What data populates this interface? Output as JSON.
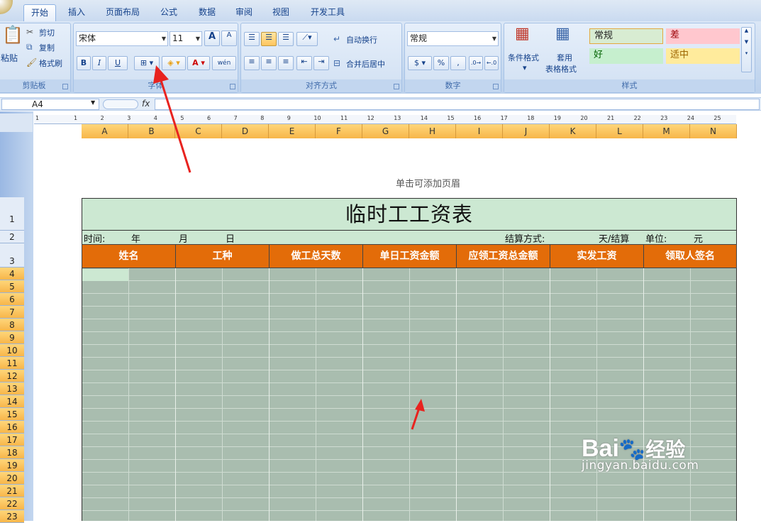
{
  "tabs": [
    "开始",
    "插入",
    "页面布局",
    "公式",
    "数据",
    "审阅",
    "视图",
    "开发工具"
  ],
  "clipboard": {
    "paste": "粘贴",
    "cut": "剪切",
    "copy": "复制",
    "format_painter": "格式刷",
    "group": "剪贴板"
  },
  "font": {
    "name": "宋体",
    "size": "11",
    "group": "字体",
    "bold": "B",
    "italic": "I",
    "underline": "U",
    "grow": "A",
    "shrink": "A",
    "phonetic": "wén"
  },
  "alignment": {
    "wrap": "自动换行",
    "merge": "合并后居中",
    "group": "对齐方式"
  },
  "number": {
    "format": "常规",
    "percent": "%",
    "comma": ",",
    "group": "数字"
  },
  "styles": {
    "conditional": "条件格式",
    "table": "套用",
    "table2": "表格格式",
    "normal": "常规",
    "bad": "差",
    "good": "好",
    "neutral": "适中",
    "group": "样式"
  },
  "namebox": "A4",
  "fx": "fx",
  "ruler_numbers": [
    "1",
    "1",
    "2",
    "3",
    "4",
    "5",
    "6",
    "7",
    "8",
    "9",
    "10",
    "11",
    "12",
    "13",
    "14",
    "15",
    "16",
    "17",
    "18",
    "19",
    "20",
    "21",
    "22",
    "23",
    "24",
    "25"
  ],
  "columns": [
    "A",
    "B",
    "C",
    "D",
    "E",
    "F",
    "G",
    "H",
    "I",
    "J",
    "K",
    "L",
    "M",
    "N"
  ],
  "rows": [
    "1",
    "2",
    "3",
    "4",
    "5",
    "6",
    "7",
    "8",
    "9",
    "10",
    "11",
    "12",
    "13",
    "14",
    "15",
    "16",
    "17",
    "18",
    "19",
    "20",
    "21",
    "22",
    "23"
  ],
  "header_hint": "单击可添加页眉",
  "sheet": {
    "title": "临时工工资表",
    "time": "时间:",
    "year": "年",
    "month": "月",
    "day": "日",
    "settle": "结算方式:",
    "per_day": "天/结算",
    "unit": "单位:",
    "yuan": "元",
    "headers": [
      "姓名",
      "工种",
      "做工总天数",
      "单日工资金额",
      "应领工资总金额",
      "实发工资",
      "领取人签名"
    ]
  },
  "watermark": {
    "brand": "Bai",
    "brand2": "经验",
    "url": "jingyan.baidu.com"
  },
  "colors": {
    "header_orange": "#e36c09",
    "title_green": "#cce8d2",
    "selection_gray": "#a9bdaf",
    "arrow_red": "#e8231f"
  }
}
